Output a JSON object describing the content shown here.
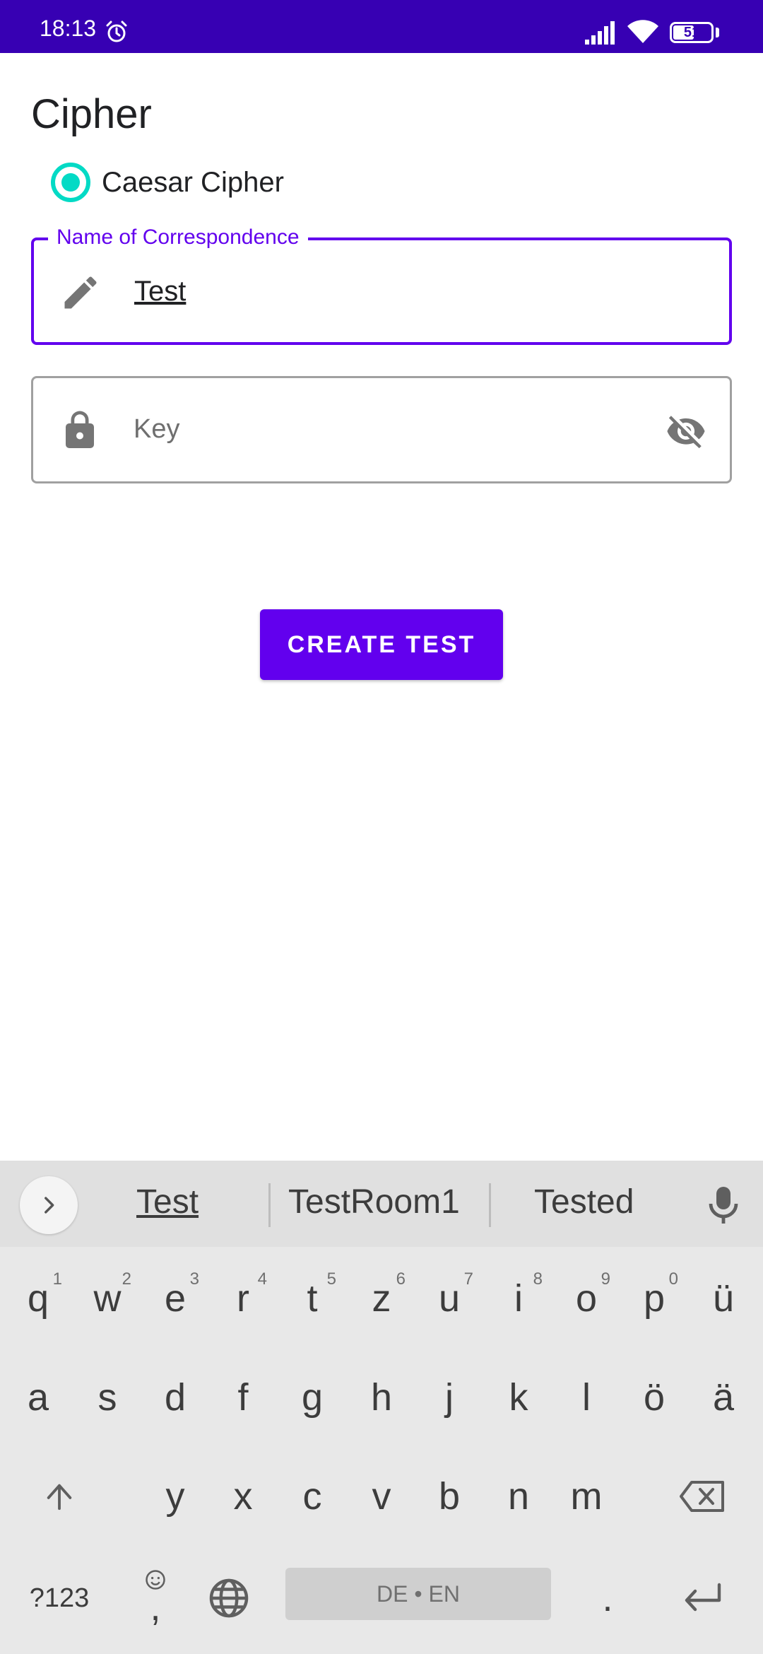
{
  "status_bar": {
    "time": "18:13",
    "battery": "51",
    "background_color": "#3700b3",
    "icons": [
      "alarm-icon",
      "signal-icon",
      "wifi-icon",
      "battery-icon"
    ]
  },
  "page": {
    "title": "Cipher"
  },
  "cipher_option": {
    "label": "Caesar Cipher",
    "selected": true,
    "accent_color": "#03dac5"
  },
  "name_field": {
    "label": "Name of Correspondence",
    "value": "Test",
    "icon": "pencil-icon",
    "focused": true,
    "accent_color": "#6200ee"
  },
  "key_field": {
    "placeholder": "Key",
    "icon": "lock-icon",
    "toggle_icon": "eye-off-icon"
  },
  "create_button": {
    "label": "CREATE TEST",
    "color": "#6200ee"
  },
  "keyboard": {
    "suggestions": [
      "Test",
      "TestRoom1",
      "Tested"
    ],
    "row1": [
      {
        "key": "q",
        "hint": "1"
      },
      {
        "key": "w",
        "hint": "2"
      },
      {
        "key": "e",
        "hint": "3"
      },
      {
        "key": "r",
        "hint": "4"
      },
      {
        "key": "t",
        "hint": "5"
      },
      {
        "key": "z",
        "hint": "6"
      },
      {
        "key": "u",
        "hint": "7"
      },
      {
        "key": "i",
        "hint": "8"
      },
      {
        "key": "o",
        "hint": "9"
      },
      {
        "key": "p",
        "hint": "0"
      },
      {
        "key": "ü",
        "hint": ""
      }
    ],
    "row2": [
      "a",
      "s",
      "d",
      "f",
      "g",
      "h",
      "j",
      "k",
      "l",
      "ö",
      "ä"
    ],
    "row3": [
      "y",
      "x",
      "c",
      "v",
      "b",
      "n",
      "m"
    ],
    "symbols_key": "?123",
    "comma_key": ",",
    "period_key": ".",
    "space_label": "DE • EN"
  }
}
